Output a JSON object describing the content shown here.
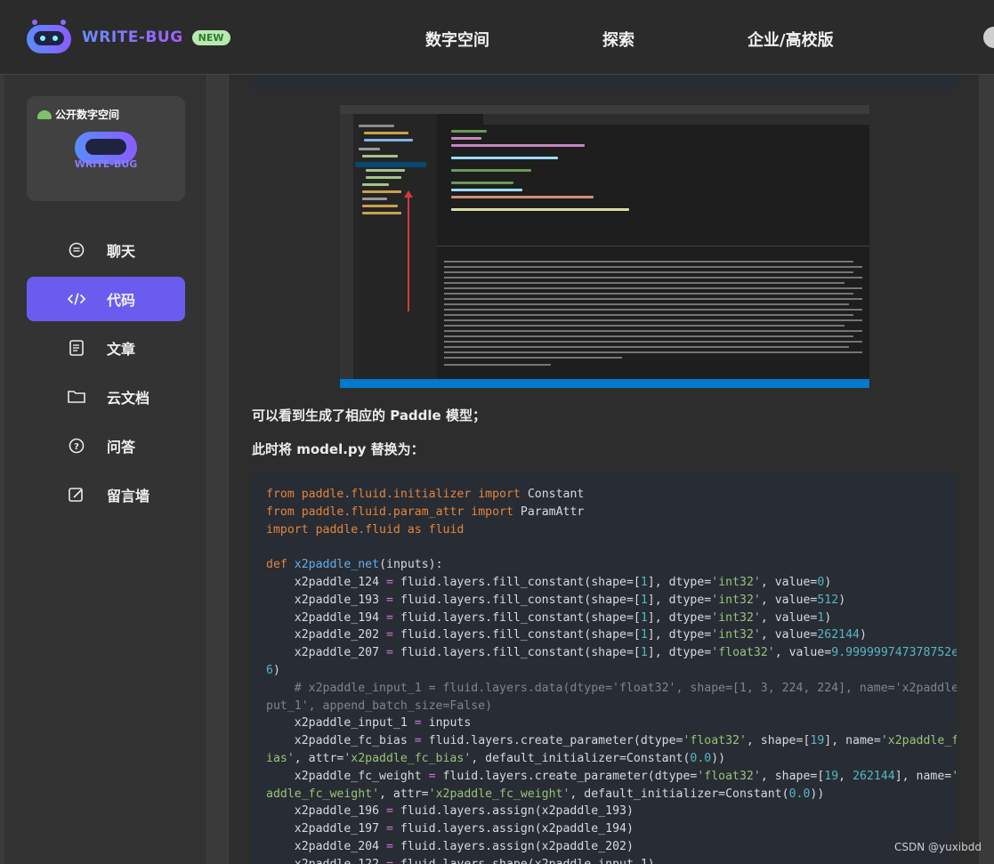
{
  "header": {
    "brand": "WRITE-BUG",
    "badge": "NEW",
    "nav": [
      "数字空间",
      "探索",
      "企业/高校版"
    ]
  },
  "sidebar": {
    "card_label": "公开数字空间",
    "card_brand": "WRITE-BUG",
    "items": [
      {
        "label": "聊天",
        "icon": "chat-icon"
      },
      {
        "label": "代码",
        "icon": "code-icon",
        "active": true
      },
      {
        "label": "文章",
        "icon": "article-icon"
      },
      {
        "label": "云文档",
        "icon": "folder-icon"
      },
      {
        "label": "问答",
        "icon": "question-icon"
      },
      {
        "label": "留言墙",
        "icon": "edit-icon"
      }
    ]
  },
  "article": {
    "para1": "可以看到生成了相应的 Paddle 模型；",
    "para2": "此时将 model.py 替换为："
  },
  "watermark": "CSDN @yuxibdd",
  "colors": {
    "accent": "#6b5cf0",
    "code_bg": "#282c34",
    "page_bg": "#2d2d2d"
  }
}
